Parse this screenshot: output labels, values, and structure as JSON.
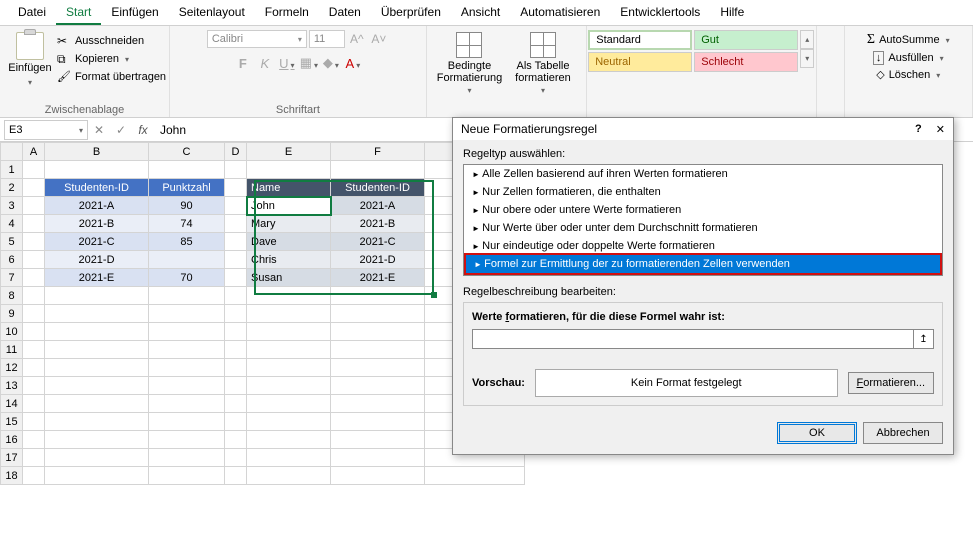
{
  "menu": {
    "items": [
      "Datei",
      "Start",
      "Einfügen",
      "Seitenlayout",
      "Formeln",
      "Daten",
      "Überprüfen",
      "Ansicht",
      "Automatisieren",
      "Entwicklertools",
      "Hilfe"
    ],
    "active": 1
  },
  "ribbon": {
    "clipboard": {
      "paste": "Einfügen",
      "cut": "Ausschneiden",
      "copy": "Kopieren",
      "painter": "Format übertragen",
      "group": "Zwischenablage"
    },
    "font": {
      "name": "Calibri",
      "size": "11",
      "group": "Schriftart"
    },
    "cond": {
      "conditional": "Bedingte Formatierung",
      "astable": "Als Tabelle formatieren"
    },
    "styles": {
      "standard": "Standard",
      "gut": "Gut",
      "neutral": "Neutral",
      "schlecht": "Schlecht"
    },
    "edit": {
      "autosum": "AutoSumme",
      "fill": "Ausfüllen",
      "clear": "Löschen"
    }
  },
  "namebox": "E3",
  "formula": "John",
  "columns": [
    "A",
    "B",
    "C",
    "D",
    "E",
    "F"
  ],
  "table1": {
    "headers": [
      "Studenten-ID",
      "Punktzahl"
    ],
    "rows": [
      [
        "2021-A",
        "90"
      ],
      [
        "2021-B",
        "74"
      ],
      [
        "2021-C",
        "85"
      ],
      [
        "2021-D",
        ""
      ],
      [
        "2021-E",
        "70"
      ]
    ]
  },
  "table2": {
    "headers": [
      "Name",
      "Studenten-ID"
    ],
    "rows": [
      [
        "John",
        "2021-A"
      ],
      [
        "Mary",
        "2021-B"
      ],
      [
        "Dave",
        "2021-C"
      ],
      [
        "Chris",
        "2021-D"
      ],
      [
        "Susan",
        "2021-E"
      ]
    ]
  },
  "dialog": {
    "title": "Neue Formatierungsregel",
    "select_label": "Regeltyp auswählen:",
    "rules": [
      "Alle Zellen basierend auf ihren Werten formatieren",
      "Nur Zellen formatieren, die enthalten",
      "Nur obere oder untere Werte formatieren",
      "Nur Werte über oder unter dem Durchschnitt formatieren",
      "Nur eindeutige oder doppelte Werte formatieren",
      "Formel zur Ermittlung der zu formatierenden Zellen verwenden"
    ],
    "desc_label": "Regelbeschreibung bearbeiten:",
    "formula_label_pre": "Werte ",
    "formula_label_u": "f",
    "formula_label_post": "ormatieren, für die diese Formel wahr ist:",
    "preview_label": "Vorschau:",
    "no_format": "Kein Format festgelegt",
    "format_btn_u": "F",
    "format_btn_post": "ormatieren...",
    "ok": "OK",
    "cancel": "Abbrechen"
  }
}
